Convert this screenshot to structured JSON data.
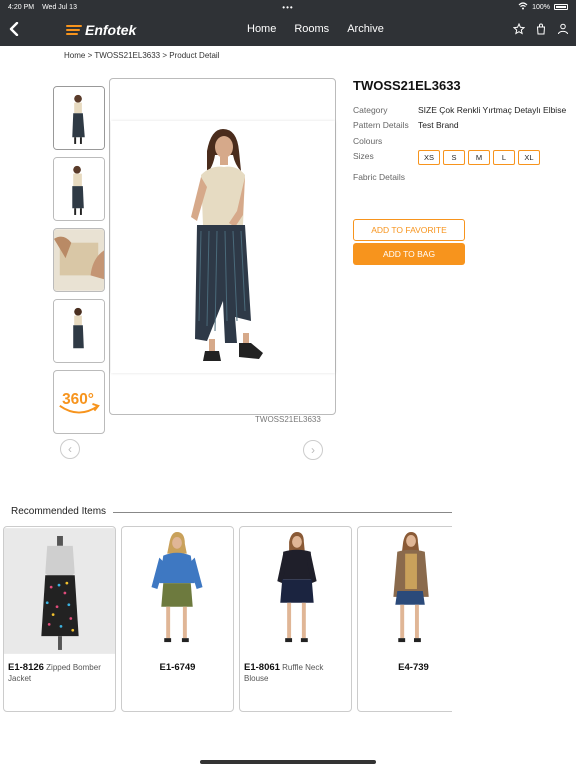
{
  "status_bar": {
    "time": "4:20 PM",
    "date": "Wed Jul 13",
    "dots": "•••",
    "battery": "100%"
  },
  "nav": {
    "brand": "Enfotek",
    "links": [
      "Home",
      "Rooms",
      "Archive"
    ]
  },
  "breadcrumb": "Home > TWOSS21EL3633 > Product Detail",
  "product": {
    "code": "TWOSS21EL3633",
    "image_code": "TWOSS21EL3633",
    "specs": {
      "category_label": "Category",
      "category_value": "SIZE Çok Renkli Yırtmaç Detaylı Elbise",
      "pattern_label": "Pattern Details",
      "pattern_value": "Test Brand",
      "colours_label": "Colours",
      "sizes_label": "Sizes",
      "fabric_label": "Fabric Details"
    },
    "sizes": [
      "XS",
      "S",
      "M",
      "L",
      "XL"
    ],
    "add_favorite": "ADD TO FAVORITE",
    "add_bag": "ADD TO BAG",
    "view_360": "360°"
  },
  "recommended": {
    "heading": "Recommended Items",
    "items": [
      {
        "code": "E1-8126",
        "name": "Zipped Bomber Jacket"
      },
      {
        "code": "E1-6749",
        "name": ""
      },
      {
        "code": "E1-8061",
        "name": "Ruffle Neck Blouse"
      },
      {
        "code": "E4-739",
        "name": ""
      }
    ]
  },
  "colors": {
    "accent": "#f7941d",
    "nav_bg": "#2f3236"
  },
  "icons": {
    "back": "chevron-left-icon",
    "favorite": "star-icon",
    "bag": "bag-icon",
    "user": "user-icon",
    "prev": "chevron-left-circle-icon",
    "next": "chevron-right-circle-icon"
  }
}
